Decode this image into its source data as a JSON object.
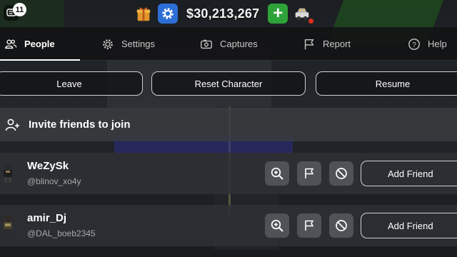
{
  "hud": {
    "notification_count": "11",
    "money": "$30,213,267",
    "plus_label": "+"
  },
  "tabs": [
    {
      "label": "People",
      "icon": "people-icon",
      "active": true
    },
    {
      "label": "Settings",
      "icon": "gear-icon",
      "active": false
    },
    {
      "label": "Captures",
      "icon": "camera-icon",
      "active": false
    },
    {
      "label": "Report",
      "icon": "flag-icon",
      "active": false
    },
    {
      "label": "Help",
      "icon": "help-icon",
      "active": false
    }
  ],
  "actions": {
    "leave": "Leave",
    "reset": "Reset Character",
    "resume": "Resume"
  },
  "invite": {
    "label": "Invite friends to join"
  },
  "players": [
    {
      "name": "WeZySk",
      "handle": "@blinov_xo4y",
      "add_label": "Add Friend"
    },
    {
      "name": "amir_Dj",
      "handle": "@DAL_boeb2345",
      "add_label": "Add Friend"
    }
  ],
  "colors": {
    "accent_blue": "#2d6fd6",
    "plus_green": "#2ea33a",
    "panel_dark": "#121214",
    "row_gray": "#2e3034"
  }
}
